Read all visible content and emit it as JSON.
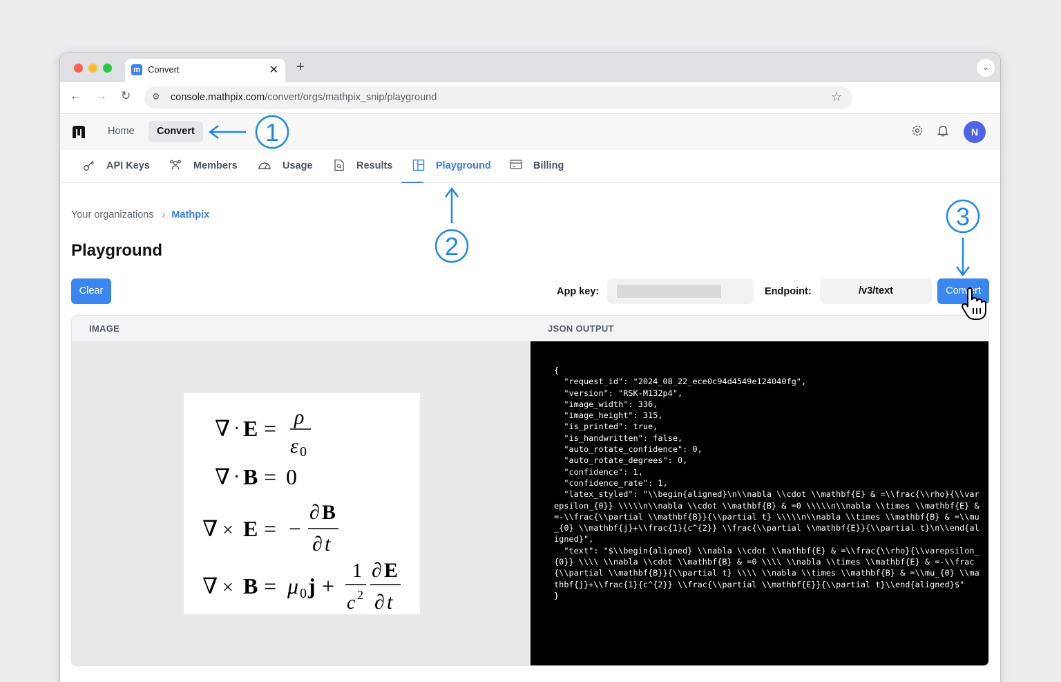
{
  "browser": {
    "tab_title": "Convert",
    "tab_favicon": "mathpix-logo-icon",
    "url_host": "console.mathpix.com",
    "url_path": "/convert/orgs/mathpix_snip/playground"
  },
  "header": {
    "home_label": "Home",
    "convert_label": "Convert",
    "avatar_initial": "N"
  },
  "subnav": {
    "items": [
      {
        "label": "API Keys",
        "icon": "key-icon"
      },
      {
        "label": "Members",
        "icon": "members-icon"
      },
      {
        "label": "Usage",
        "icon": "gauge-icon"
      },
      {
        "label": "Results",
        "icon": "document-search-icon"
      },
      {
        "label": "Playground",
        "icon": "playground-icon",
        "active": true
      },
      {
        "label": "Billing",
        "icon": "card-icon"
      }
    ]
  },
  "breadcrumb": {
    "root": "Your organizations",
    "current": "Mathpix"
  },
  "page": {
    "title": "Playground",
    "clear_label": "Clear",
    "app_key_label": "App key:",
    "endpoint_label": "Endpoint:",
    "endpoint_value": "/v3/text",
    "convert_label": "Convert"
  },
  "panels": {
    "image_header": "IMAGE",
    "json_header": "JSON OUTPUT",
    "json_output": "{\n  \"request_id\": \"2024_08_22_ece0c94d4549e124040fg\",\n  \"version\": \"RSK-M132p4\",\n  \"image_width\": 336,\n  \"image_height\": 315,\n  \"is_printed\": true,\n  \"is_handwritten\": false,\n  \"auto_rotate_confidence\": 0,\n  \"auto_rotate_degrees\": 0,\n  \"confidence\": 1,\n  \"confidence_rate\": 1,\n  \"latex_styled\": \"\\\\begin{aligned}\\n\\\\nabla \\\\cdot \\\\mathbf{E} & =\\\\frac{\\\\rho}{\\\\varepsilon_{0}} \\\\\\\\\\n\\\\nabla \\\\cdot \\\\mathbf{B} & =0 \\\\\\\\\\n\\\\nabla \\\\times \\\\mathbf{E} & =-\\\\frac{\\\\partial \\\\mathbf{B}}{\\\\partial t} \\\\\\\\\\n\\\\nabla \\\\times \\\\mathbf{B} & =\\\\mu_{0} \\\\mathbf{j}+\\\\frac{1}{c^{2}} \\\\frac{\\\\partial \\\\mathbf{E}}{\\\\partial t}\\n\\\\end{aligned}\",\n  \"text\": \"$\\\\begin{aligned} \\\\nabla \\\\cdot \\\\mathbf{E} & =\\\\frac{\\\\rho}{\\\\varepsilon_{0}} \\\\\\\\ \\\\nabla \\\\cdot \\\\mathbf{B} & =0 \\\\\\\\ \\\\nabla \\\\times \\\\mathbf{E} & =-\\\\frac{\\\\partial \\\\mathbf{B}}{\\\\partial t} \\\\\\\\ \\\\nabla \\\\times \\\\mathbf{B} & =\\\\mu_{0} \\\\mathbf{j}+\\\\frac{1}{c^{2}} \\\\frac{\\\\partial \\\\mathbf{E}}{\\\\partial t}\\\\end{aligned}$\"\n}"
  },
  "equations": {
    "nabla": "∇",
    "dot": "·",
    "cross": "×",
    "E": "E",
    "B": "B",
    "eq": "=",
    "rho": "ρ",
    "eps": "ε",
    "sub0": "0",
    "zero": "0",
    "minus": "−",
    "partial": "∂",
    "t": "t",
    "mu": "μ",
    "j": "j",
    "plus": "+",
    "one": "1",
    "c": "c",
    "sup2": "2"
  },
  "annotations": {
    "step1": "1",
    "step2": "2",
    "step3": "3",
    "color": "#1e88e5"
  },
  "colors": {
    "accent": "#3b7ee8",
    "button": "#3c86f1",
    "avatar": "#4f63e6"
  }
}
